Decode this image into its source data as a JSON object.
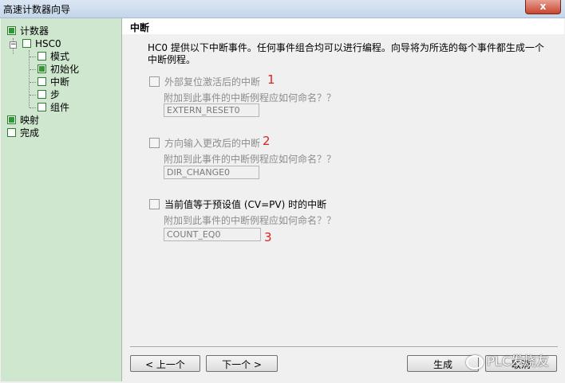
{
  "window": {
    "title": "高速计数器向导",
    "close_label": "x"
  },
  "sidebar": {
    "items": [
      {
        "label": "计数器",
        "checked": true
      },
      {
        "label": "HSC0",
        "checked": false
      },
      {
        "label": "模式",
        "checked": false
      },
      {
        "label": "初始化",
        "checked": true
      },
      {
        "label": "中断",
        "checked": false
      },
      {
        "label": "步",
        "checked": false
      },
      {
        "label": "组件",
        "checked": false
      },
      {
        "label": "映射",
        "checked": true
      },
      {
        "label": "完成",
        "checked": false
      }
    ]
  },
  "main": {
    "heading": "中断",
    "description": "HC0 提供以下中断事件。任何事件组合均可以进行编程。向导将为所选的每个事件都生成一个中断例程。",
    "options": [
      {
        "label": "外部复位激活后的中断",
        "enabled": false,
        "checked": false,
        "sub_label": "附加到此事件的中断例程应如何命名？？",
        "value": "EXTERN_RESET0",
        "annotation": "1"
      },
      {
        "label": "方向输入更改后的中断",
        "enabled": false,
        "checked": false,
        "sub_label": "附加到此事件的中断例程应如何命名？？",
        "value": "DIR_CHANGE0",
        "annotation": "2"
      },
      {
        "label": "当前值等于预设值 (CV=PV) 时的中断",
        "enabled": true,
        "checked": false,
        "sub_label": "附加到此事件的中断例程应如何命名？？",
        "value": "COUNT_EQ0",
        "annotation": "3"
      }
    ]
  },
  "buttons": {
    "prev": "< 上一个",
    "next": "下一个 >",
    "generate": "生成",
    "cancel": "取消"
  },
  "watermark": "PLC发烧友"
}
